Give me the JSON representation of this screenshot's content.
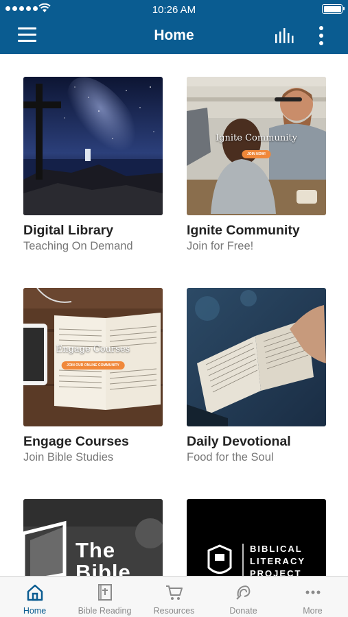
{
  "status_bar": {
    "time": "10:26 AM"
  },
  "nav": {
    "title": "Home"
  },
  "cards": [
    {
      "title": "Digital Library",
      "subtitle": "Teaching On Demand"
    },
    {
      "title": "Ignite Community",
      "subtitle": "Join for Free!",
      "image_title": "Ignite Community",
      "image_button": "JOIN NOW!"
    },
    {
      "title": "Engage Courses",
      "subtitle": "Join Bible Studies",
      "image_title": "Engage Courses",
      "image_button": "JOIN OUR ONLINE COMMUNITY"
    },
    {
      "title": "Daily Devotional",
      "subtitle": "Food for the Soul"
    },
    {
      "image_title_line1": "The",
      "image_title_line2": "Bible"
    },
    {
      "image_lines": [
        "BIBLICAL",
        "LITERACY",
        "PROJECT"
      ]
    }
  ],
  "tabs": [
    {
      "label": "Home",
      "icon": "home-icon",
      "active": true
    },
    {
      "label": "Bible Reading",
      "icon": "bible-icon",
      "active": false
    },
    {
      "label": "Resources",
      "icon": "cart-icon",
      "active": false
    },
    {
      "label": "Donate",
      "icon": "donate-icon",
      "active": false
    },
    {
      "label": "More",
      "icon": "more-icon",
      "active": false
    }
  ],
  "colors": {
    "header": "#0a5c91",
    "accent": "#f0883a",
    "tab_active": "#0a5c91",
    "tab_inactive": "#8a8a8a"
  }
}
